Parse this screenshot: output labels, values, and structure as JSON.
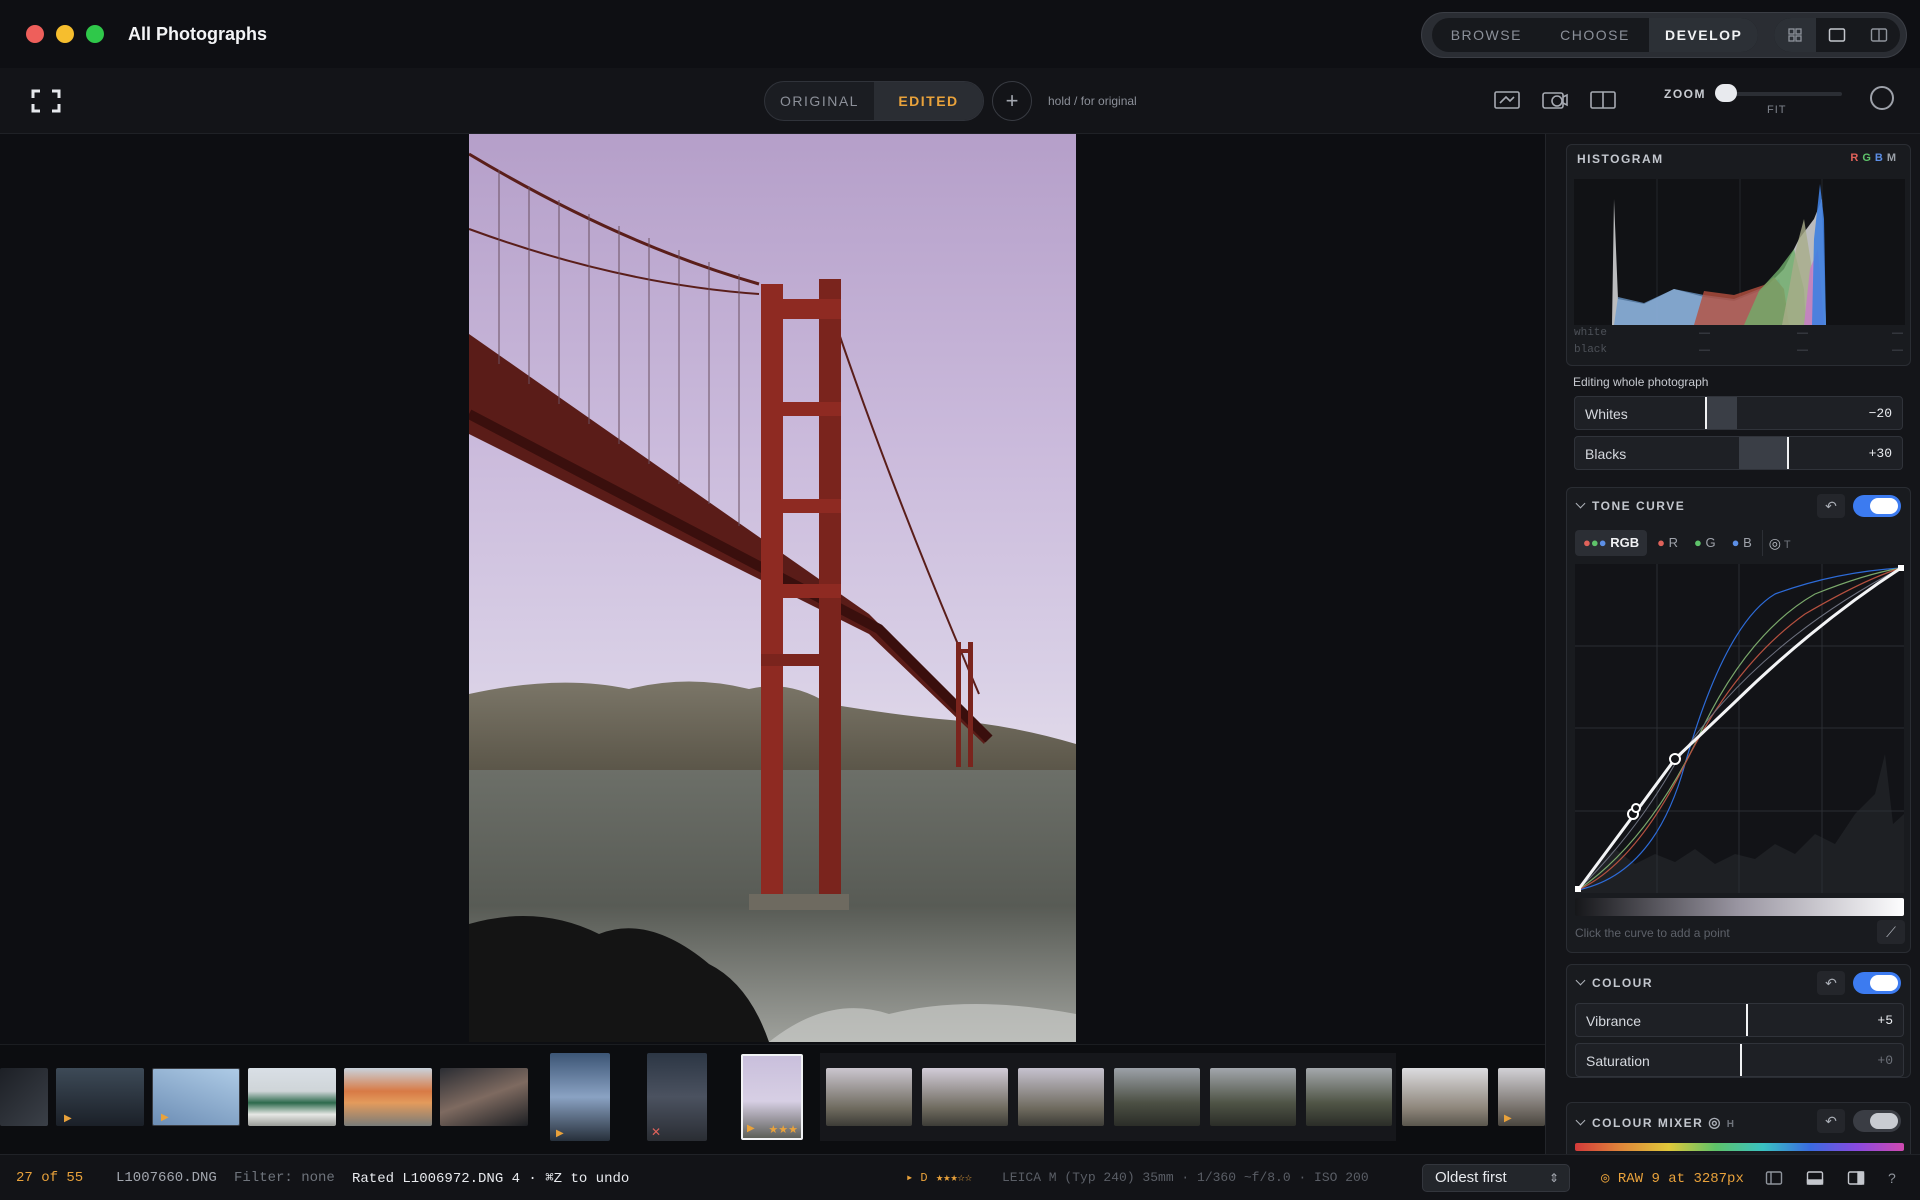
{
  "window": {
    "title": "All Photographs",
    "traffic": {
      "close": "#ee5f5b",
      "minimize": "#f6be2e",
      "maximize": "#2fc84a"
    }
  },
  "modes": [
    {
      "label": "BROWSE"
    },
    {
      "label": "CHOOSE"
    },
    {
      "label": "DEVELOP",
      "active": true
    }
  ],
  "toolbar": {
    "original_label": "ORIGINAL",
    "edited_label": "EDITED",
    "add_label": "+",
    "hold_hint": "hold  /  for original",
    "zoom_label": "ZOOM",
    "zoom_mode": "FIT"
  },
  "histogram": {
    "title": "HISTOGRAM",
    "channels": [
      "R",
      "G",
      "B",
      "M"
    ],
    "white_label": "white",
    "black_label": "black",
    "placeholder": "—"
  },
  "editing_scope": "Editing whole photograph",
  "tone": {
    "whites": {
      "label": "Whites",
      "value": "−20",
      "fraction": 0.42
    },
    "blacks": {
      "label": "Blacks",
      "value": "+30",
      "fraction": 0.65
    }
  },
  "tone_curve": {
    "title": "TONE CURVE",
    "channels": [
      {
        "label": "RGB",
        "active": true
      },
      {
        "label": "R"
      },
      {
        "label": "G"
      },
      {
        "label": "B"
      }
    ],
    "extra_label": "T",
    "hint": "Click the curve to add a point",
    "enabled": true
  },
  "colour": {
    "title": "COLOUR",
    "enabled": true,
    "vibrance": {
      "label": "Vibrance",
      "value": "+5",
      "fraction": 0.52
    },
    "saturation": {
      "label": "Saturation",
      "value": "+0",
      "fraction": 0.5
    }
  },
  "colour_mixer": {
    "title": "COLOUR MIXER",
    "extra_label": "H",
    "enabled": false
  },
  "filmstrip": {
    "current_rating": "★★★"
  },
  "status": {
    "position": "27 of 55",
    "filename": "L1007660.DNG",
    "filter": "Filter: none",
    "message": "Rated L1006972.DNG 4 · ⌘Z to undo",
    "flag": "▸ D",
    "stars": "★★★☆☆",
    "camera": "LEICA M (Typ 240) 35mm · 1/360 ~f/8.0 · ISO 200",
    "sort": "Oldest first",
    "raw_info": "RAW 9 at 3287px",
    "help": "?"
  },
  "colors": {
    "accent": "#e9a23b",
    "toggle_on": "#3c7bf0",
    "background": "#101014"
  }
}
